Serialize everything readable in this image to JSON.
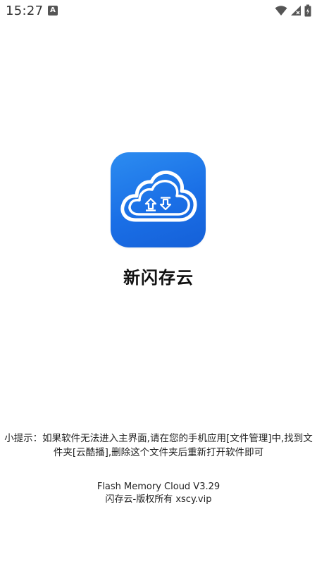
{
  "status_bar": {
    "time": "15:27",
    "notification_glyph": "A",
    "icons": [
      "wifi-icon",
      "cell-signal-icon",
      "battery-icon"
    ]
  },
  "app": {
    "logo_icon": "cloud-upload-download-icon",
    "logo_color": "#1a6fe6",
    "name": "新闪存云"
  },
  "tip": {
    "line1": "小提示：如果软件无法进入主界面,请在您的手机应用[文件管理]中,找到文",
    "line2": "件夹[云酷播],删除这个文件夹后重新打开软件即可"
  },
  "footer": {
    "version": "Flash Memory Cloud V3.29",
    "copyright": "闪存云-版权所有 xscy.vip"
  }
}
